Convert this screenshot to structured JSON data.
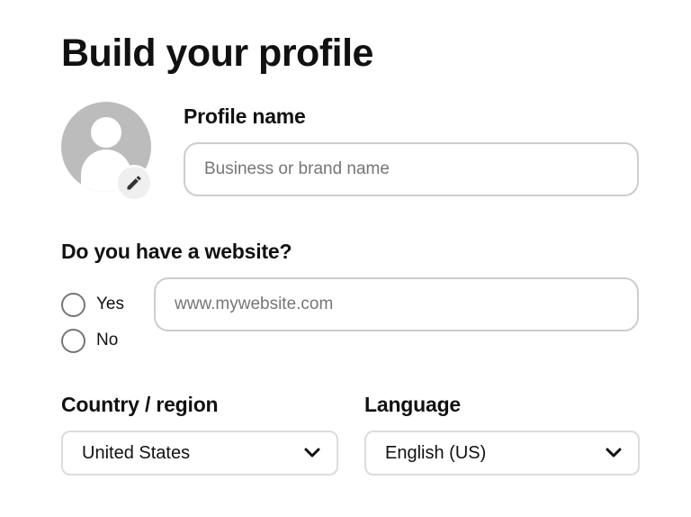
{
  "page": {
    "title": "Build your profile"
  },
  "profile": {
    "avatar_icon": "user-placeholder-icon",
    "edit_icon": "pencil-icon",
    "name_label": "Profile name",
    "name_placeholder": "Business or brand name",
    "name_value": ""
  },
  "website": {
    "question": "Do you have a website?",
    "options": [
      {
        "label": "Yes",
        "selected": false
      },
      {
        "label": "No",
        "selected": false
      }
    ],
    "url_placeholder": "www.mywebsite.com",
    "url_value": ""
  },
  "country": {
    "label": "Country / region",
    "selected": "United States",
    "icon": "chevron-down-icon"
  },
  "language": {
    "label": "Language",
    "selected": "English (US)",
    "icon": "chevron-down-icon"
  },
  "colors": {
    "border": "#cdcdcd",
    "avatar_bg": "#bcbcbc",
    "placeholder": "#767676"
  }
}
